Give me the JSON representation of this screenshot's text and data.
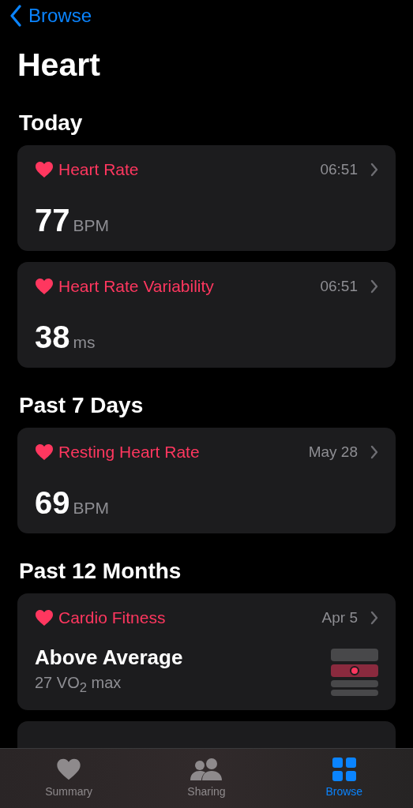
{
  "nav": {
    "back": "Browse",
    "title": "Heart"
  },
  "sections": [
    {
      "title": "Today",
      "cards": [
        {
          "kind": "metric",
          "title": "Heart Rate",
          "time": "06:51",
          "value": "77",
          "unit": "BPM"
        },
        {
          "kind": "metric",
          "title": "Heart Rate Variability",
          "time": "06:51",
          "value": "38",
          "unit": "ms"
        }
      ]
    },
    {
      "title": "Past 7 Days",
      "cards": [
        {
          "kind": "metric",
          "title": "Resting Heart Rate",
          "time": "May 28",
          "value": "69",
          "unit": "BPM"
        }
      ]
    },
    {
      "title": "Past 12 Months",
      "cards": [
        {
          "kind": "fitness",
          "title": "Cardio Fitness",
          "time": "Apr 5",
          "value": "Above Average",
          "detail": "27 VO$_{2}$ max"
        }
      ]
    }
  ],
  "tab_bar": [
    {
      "kind": "summary",
      "label": "Summary",
      "selected": false
    },
    {
      "kind": "sharing",
      "label": "Sharing",
      "selected": false
    },
    {
      "kind": "browse",
      "label": "Browse",
      "selected": true
    }
  ]
}
